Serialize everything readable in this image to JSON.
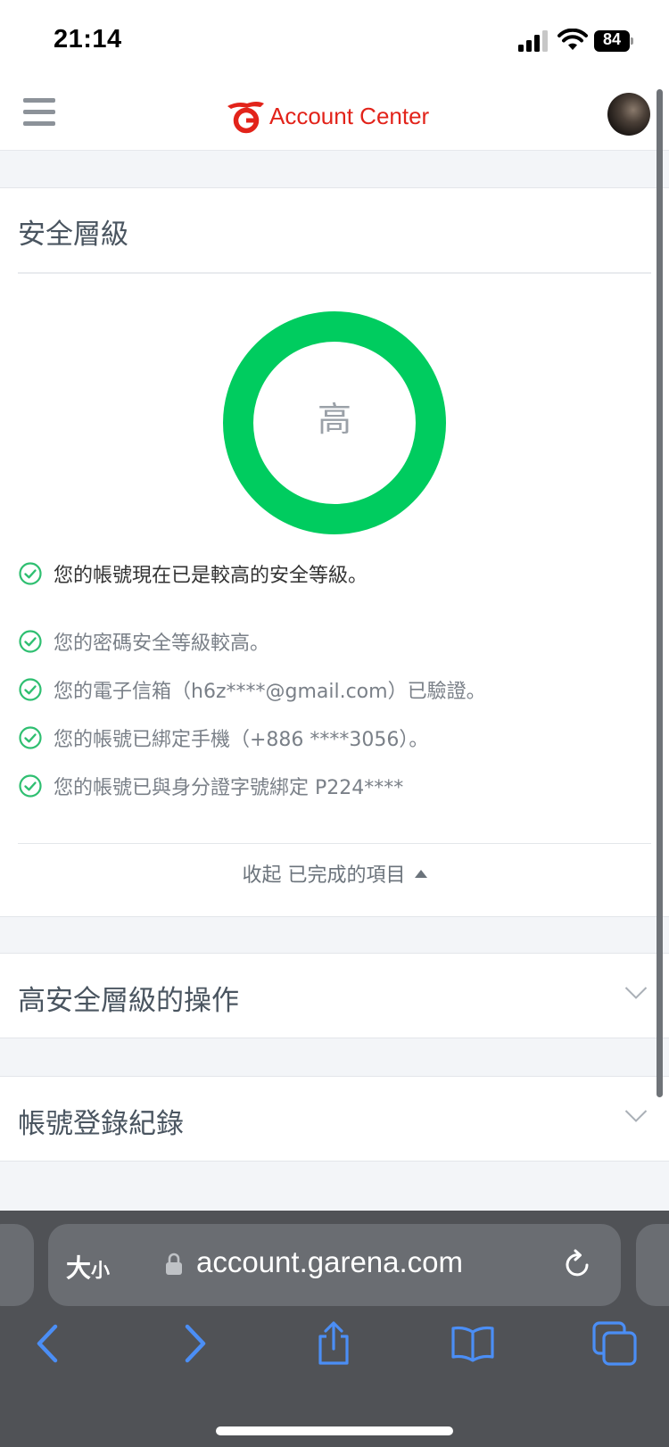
{
  "status_bar": {
    "time": "21:14",
    "battery": "84"
  },
  "header": {
    "brand_text": "Account Center"
  },
  "security": {
    "title": "安全層級",
    "level": "高",
    "ring_color": "#00cc5f",
    "check_color": "#2fbf71",
    "summary": "您的帳號現在已是較高的安全等級。",
    "items": [
      "您的密碼安全等級較高。",
      "您的電子信箱（h6z****@gmail.com）已驗證。",
      "您的帳號已綁定手機（+886 ****3056）。",
      "您的帳號已與身分證字號綁定 P224****"
    ],
    "collapse_label": "收起 已完成的項目"
  },
  "sections": [
    {
      "title": "高安全層級的操作"
    },
    {
      "title": "帳號登錄紀錄"
    }
  ],
  "browser": {
    "text_size_big": "大",
    "text_size_small": "小",
    "url": "account.garena.com"
  },
  "icons": [
    "signal-icon",
    "wifi-icon",
    "menu-icon",
    "garena-logo-icon",
    "check-circle-icon",
    "caret-up-icon",
    "chevron-down-icon",
    "lock-icon",
    "reload-icon",
    "back-icon",
    "forward-icon",
    "share-icon",
    "bookmarks-icon",
    "tabs-icon"
  ]
}
